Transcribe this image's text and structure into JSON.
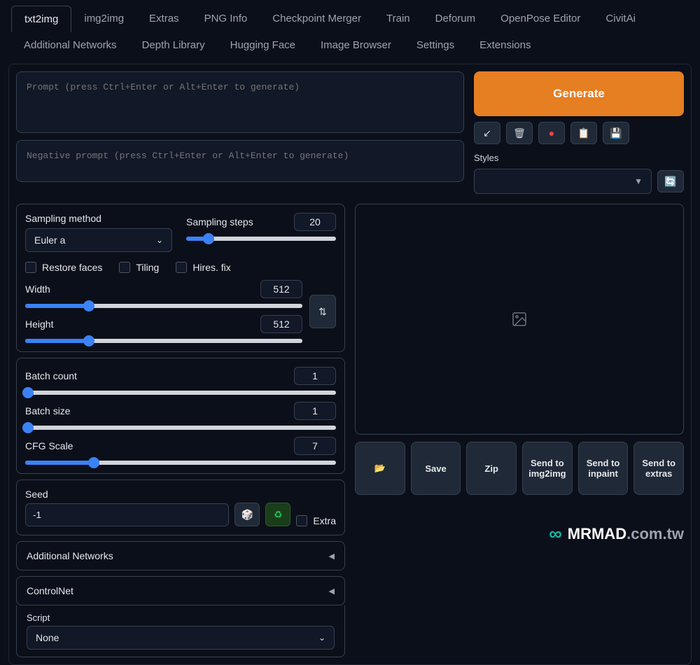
{
  "tabs_row1": [
    "txt2img",
    "img2img",
    "Extras",
    "PNG Info",
    "Checkpoint Merger",
    "Train",
    "Deforum",
    "OpenPose Editor",
    "CivitAi"
  ],
  "tabs_row2": [
    "Additional Networks",
    "Depth Library",
    "Hugging Face",
    "Image Browser",
    "Settings",
    "Extensions"
  ],
  "active_tab": "txt2img",
  "prompt": {
    "placeholder": "Prompt (press Ctrl+Enter or Alt+Enter to generate)",
    "neg_placeholder": "Negative prompt (press Ctrl+Enter or Alt+Enter to generate)"
  },
  "generate_label": "Generate",
  "styles_label": "Styles",
  "sampling": {
    "method_label": "Sampling method",
    "method_value": "Euler a",
    "steps_label": "Sampling steps",
    "steps_value": "20"
  },
  "checkboxes": {
    "restore_faces": "Restore faces",
    "tiling": "Tiling",
    "hires_fix": "Hires. fix"
  },
  "dims": {
    "width_label": "Width",
    "width_value": "512",
    "height_label": "Height",
    "height_value": "512"
  },
  "batch": {
    "count_label": "Batch count",
    "count_value": "1",
    "size_label": "Batch size",
    "size_value": "1"
  },
  "cfg": {
    "label": "CFG Scale",
    "value": "7"
  },
  "seed": {
    "label": "Seed",
    "value": "-1",
    "extra_label": "Extra"
  },
  "accordions": {
    "additional_networks": "Additional Networks",
    "controlnet": "ControlNet",
    "script_label": "Script",
    "script_value": "None"
  },
  "actions": {
    "folder": "📂",
    "save": "Save",
    "zip": "Zip",
    "img2img": "Send to img2img",
    "inpaint": "Send to inpaint",
    "extras": "Send to extras"
  },
  "watermark": {
    "brand": "MRMAD",
    "domain": ".com.tw"
  }
}
